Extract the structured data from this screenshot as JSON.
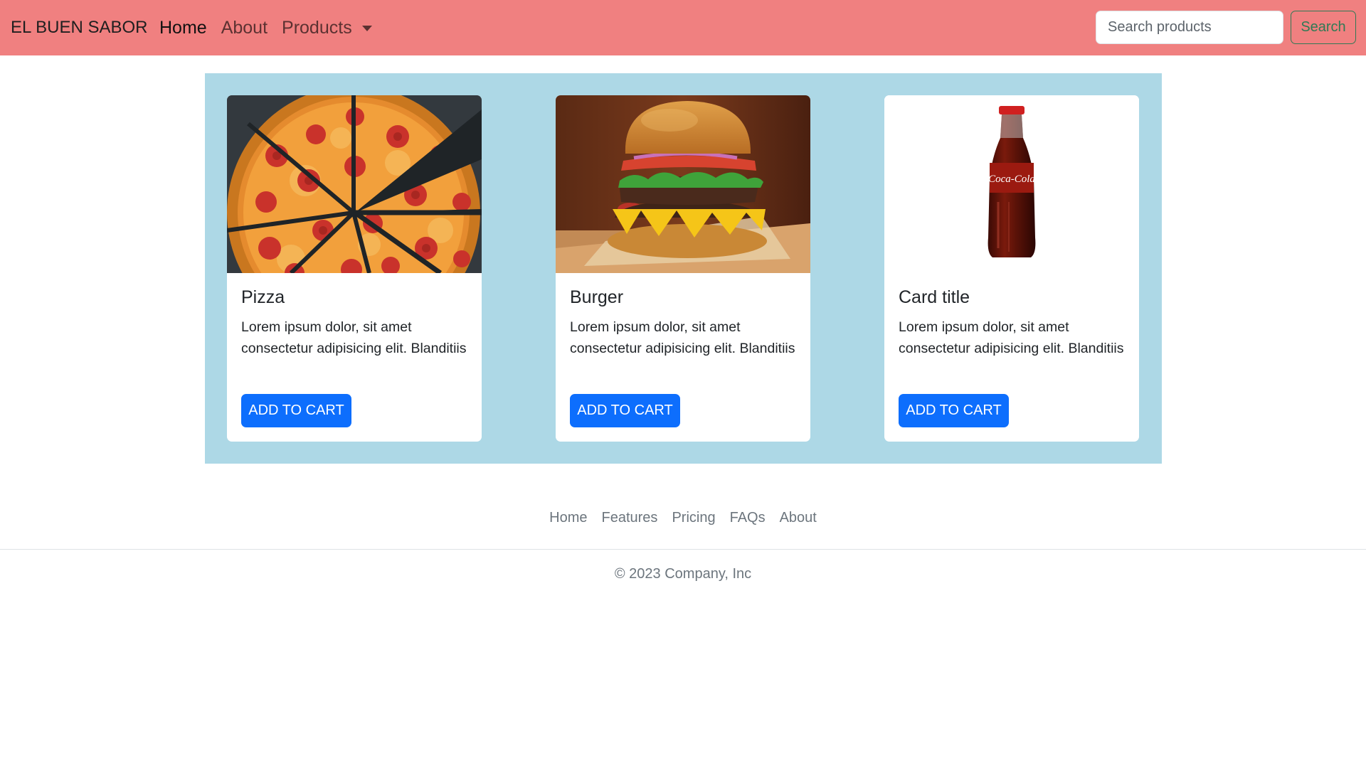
{
  "navbar": {
    "brand": "EL BUEN SABOR",
    "links": [
      {
        "label": "Home"
      },
      {
        "label": "About"
      },
      {
        "label": "Products"
      }
    ],
    "search_placeholder": "Search products",
    "search_button": "Search",
    "background": "#f08080"
  },
  "products": {
    "background": "#add8e6",
    "cards": [
      {
        "title": "Pizza",
        "text": "Lorem ipsum dolor, sit amet consectetur adipisicing elit. Blanditiis",
        "button": "ADD TO CART",
        "image": "pizza-image"
      },
      {
        "title": "Burger",
        "text": "Lorem ipsum dolor, sit amet consectetur adipisicing elit. Blanditiis",
        "button": "ADD TO CART",
        "image": "burger-image"
      },
      {
        "title": "Card title",
        "text": "Lorem ipsum dolor, sit amet consectetur adipisicing elit. Blanditiis",
        "button": "ADD TO CART",
        "image": "cola-bottle-image"
      }
    ],
    "button_color": "#0d6efd"
  },
  "footer": {
    "links": [
      {
        "label": "Home"
      },
      {
        "label": "Features"
      },
      {
        "label": "Pricing"
      },
      {
        "label": "FAQs"
      },
      {
        "label": "About"
      }
    ],
    "copyright": "© 2023 Company, Inc"
  }
}
